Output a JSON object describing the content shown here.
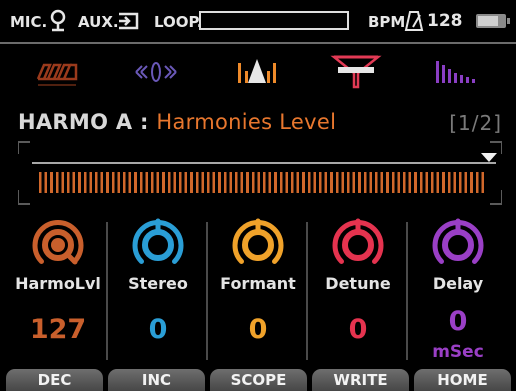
{
  "status": {
    "mic_label": "MIC.",
    "aux_label": "AUX.",
    "loop_label": "LOOP.",
    "bpm_label": "BPM",
    "bpm_value": "128",
    "battery_level": 0.75,
    "icons": [
      "mic-icon",
      "aux-input-icon",
      "metronome-icon",
      "battery-icon"
    ]
  },
  "fx_chain": [
    {
      "name": "effect-icon-1",
      "color": "#9a3a1c",
      "active": false
    },
    {
      "name": "effect-icon-2",
      "color": "#6a58b8",
      "active": false
    },
    {
      "name": "harmony-icon",
      "color": "#ee8a2a",
      "active": true
    },
    {
      "name": "detune-icon",
      "color": "#e23a55",
      "active": false
    },
    {
      "name": "delay-icon",
      "color": "#8a3ec4",
      "active": false
    }
  ],
  "title": {
    "effect": "HARMO A",
    "separator": ":",
    "parameter": "Harmonies Level",
    "page": "[1/2]"
  },
  "meter": {
    "accent": "#d1682b"
  },
  "knobs": [
    {
      "label": "HarmoLvl",
      "value": "127",
      "unit": "",
      "color": "#c95f2c",
      "level": 1.0
    },
    {
      "label": "Stereo",
      "value": "0",
      "unit": "",
      "color": "#2a9ed6",
      "level": 0.5
    },
    {
      "label": "Formant",
      "value": "0",
      "unit": "",
      "color": "#f0a22a",
      "level": 0.5
    },
    {
      "label": "Detune",
      "value": "0",
      "unit": "",
      "color": "#e5334f",
      "level": 0.5
    },
    {
      "label": "Delay",
      "value": "0",
      "unit": "mSec",
      "color": "#9a3fc6",
      "level": 0.5
    }
  ],
  "softkeys": [
    "DEC",
    "INC",
    "SCOPE",
    "WRITE",
    "HOME"
  ]
}
